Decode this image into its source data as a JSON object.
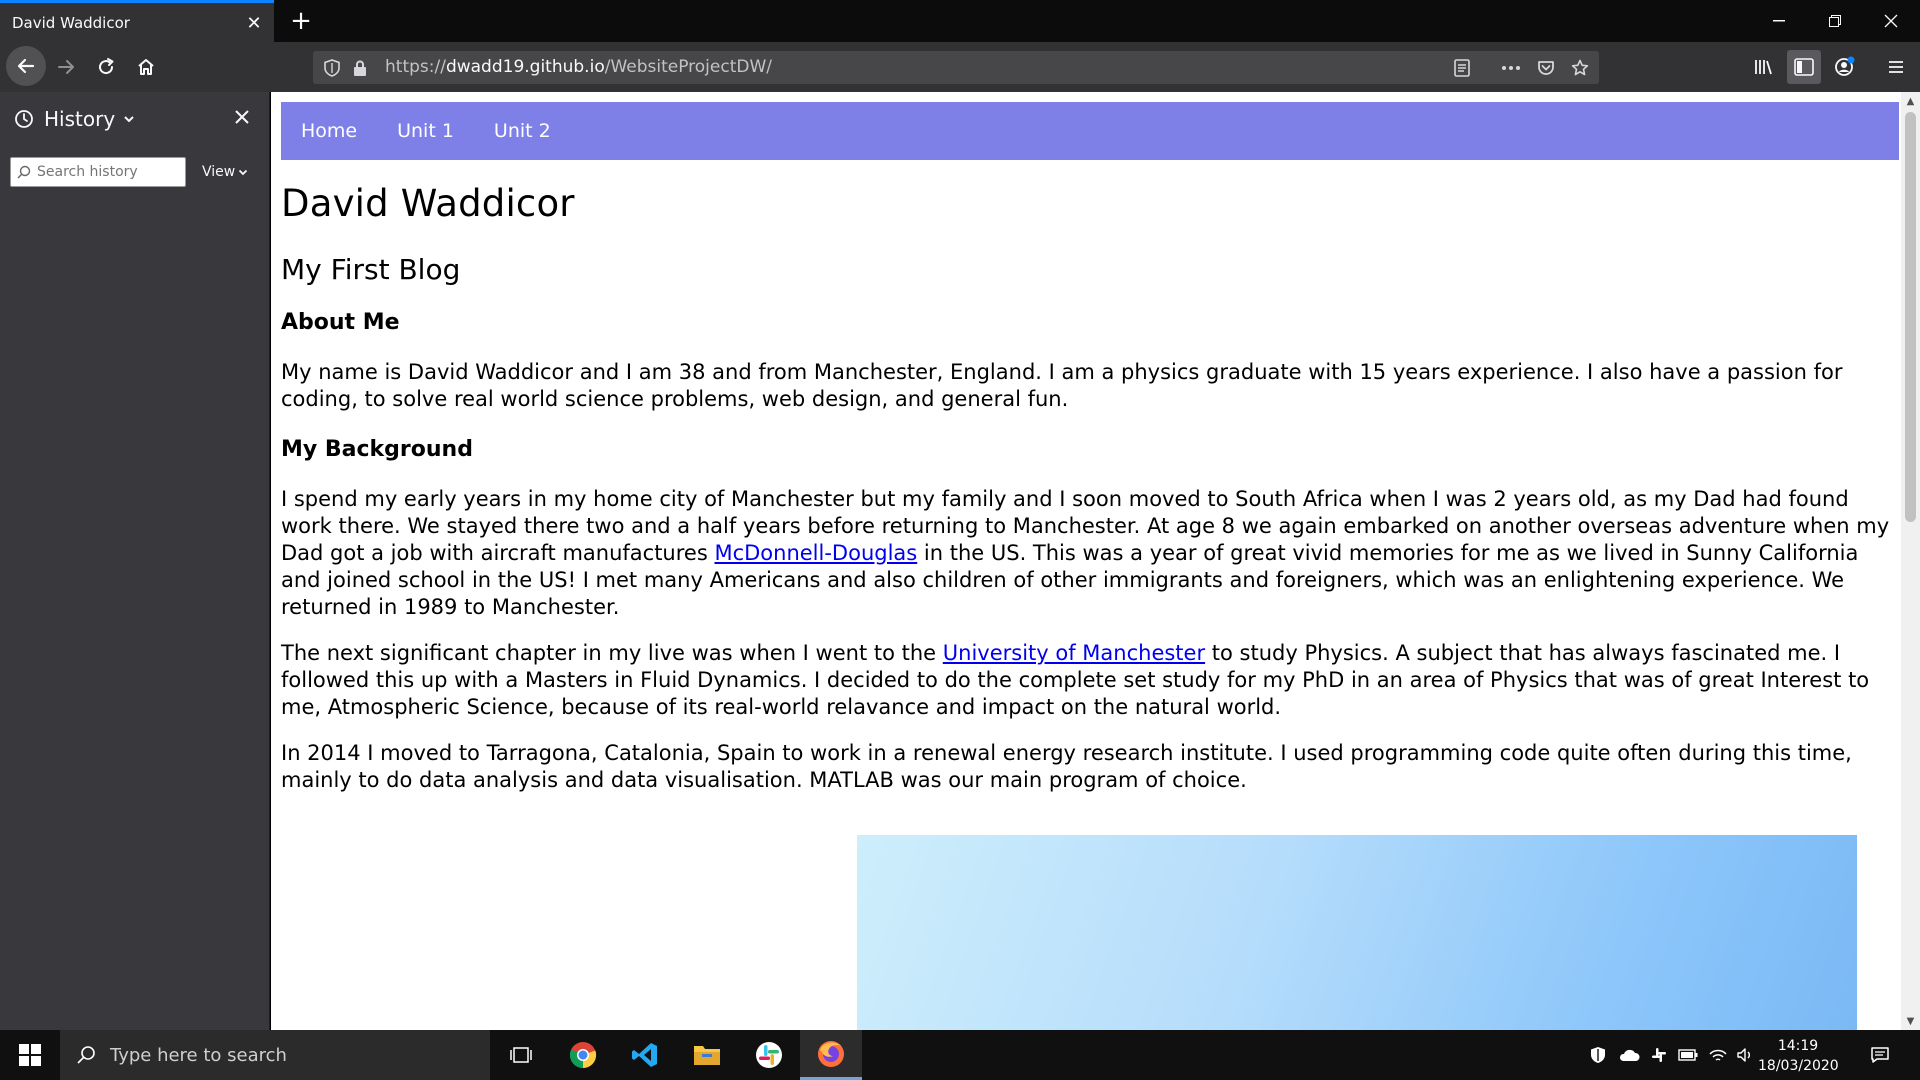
{
  "browser": {
    "tab_title": "David Waddicor",
    "url_prefix": "https://",
    "url_host": "dwadd19.github.io",
    "url_path": "/WebsiteProjectDW/"
  },
  "sidebar": {
    "title": "History",
    "search_placeholder": "Search history",
    "view_label": "View"
  },
  "site": {
    "nav": [
      "Home",
      "Unit 1",
      "Unit 2"
    ],
    "heading": "David Waddicor",
    "subheading": "My First Blog",
    "about_title": "About Me",
    "about_text": "My name is David Waddicor and I am 38 and from Manchester, England. I am a physics graduate with 15 years experience. I also have a passion for coding, to solve real world science problems, web design, and general fun.",
    "background_title": "My Background",
    "p1_before": "I spend my early years in my home city of Manchester but my family and I soon moved to South Africa when I was 2 years old, as my Dad had found work there. We stayed there two and a half years before returning to Manchester. At age 8 we again embarked on another overseas adventure when my Dad got a job with aircraft manufactures ",
    "p1_link": "McDonnell-Douglas",
    "p1_after": " in the US. This was a year of great vivid memories for me as we lived in Sunny California and joined school in the US! I met many Americans and also children of other immigrants and foreigners, which was an enlightening experience. We returned in 1989 to Manchester.",
    "p2_before": "The next significant chapter in my live was when I went to the ",
    "p2_link": "University of Manchester",
    "p2_after": " to study Physics. A subject that has always fascinated me. I followed this up with a Masters in Fluid Dynamics. I decided to do the complete set study for my PhD in an area of Physics that was of great Interest to me, Atmospheric Science, because of its real-world relavance and impact on the natural world.",
    "p3": "In 2014 I moved to Tarragona, Catalonia, Spain to work in a renewal energy research institute. I used programming code quite often during this time, mainly to do data analysis and data visualisation. MATLAB was our main program of choice."
  },
  "taskbar": {
    "search_placeholder": "Type here to search",
    "time": "14:19",
    "date": "18/03/2020"
  },
  "colors": {
    "nav_bar": "#7f7fe8",
    "tab_accent": "#0a84ff",
    "link": "#0000ee"
  }
}
